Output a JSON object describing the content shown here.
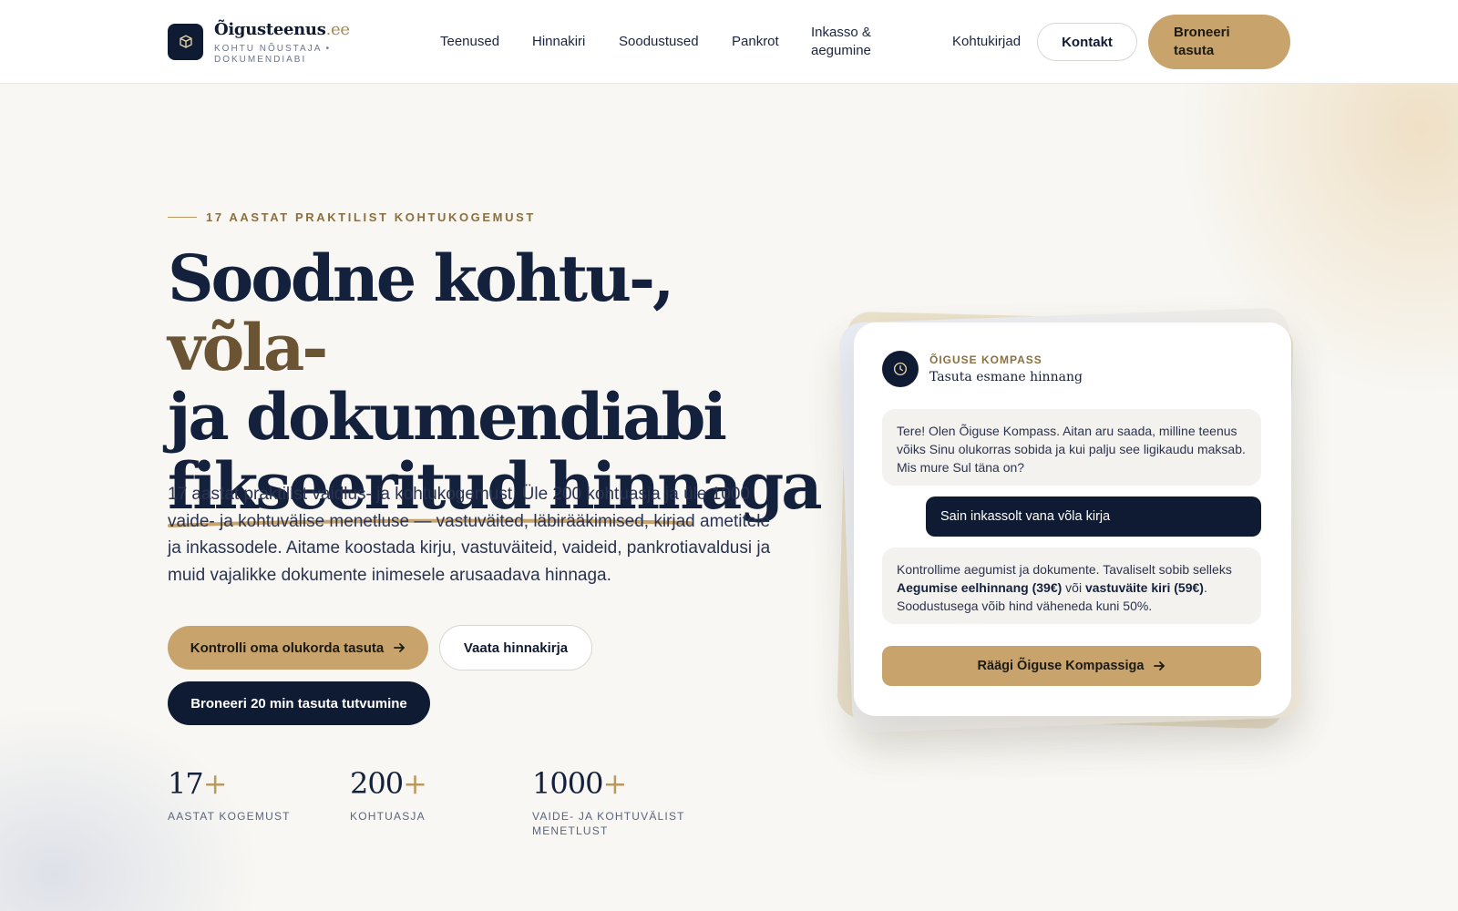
{
  "brand": {
    "name": "Õigusteenus",
    "tld": ".ee",
    "tagline": "KOHTU NÕUSTAJA • DOKUMENDIABI"
  },
  "nav": {
    "items": [
      "Teenused",
      "Hinnakiri",
      "Soodustused",
      "Pankrot",
      "Inkasso & aegumine",
      "Kohtukirjad"
    ],
    "contact_label": "Kontakt",
    "book_label": "Broneeri tasuta"
  },
  "hero": {
    "eyebrow": "17 AASTAT PRAKTILIST KOHTUKOGEMUST",
    "headline_part1": "Soodne kohtu-, ",
    "headline_gold": "võla-",
    "headline_part2": "ja dokumendiabi",
    "headline_underlined": "fikseeritud hinnaga",
    "intro": "17 aastat praktilist vaidlus- ja kohtukogemust. Üle 200 kohtuasja ja üle 1000 vaide- ja kohtuvälise menetluse — vastuväited, läbirääkimised, kirjad ametitele ja inkassodele. Aitame koostada kirju, vastuväiteid, vaideid, pankrotiavaldusi ja muid vajalikke dokumente inimesele arusaadava hinnaga.",
    "cta_primary": "Kontrolli oma olukorda tasuta",
    "cta_secondary": "Vaata hinnakirja",
    "cta_dark": "Broneeri 20 min tasuta tutvumine"
  },
  "stats": [
    {
      "value": "17",
      "suffix": "+",
      "label": "AASTAT KOGEMUST"
    },
    {
      "value": "200",
      "suffix": "+",
      "label": "KOHTUASJA"
    },
    {
      "value": "1000",
      "suffix": "+",
      "label": "VAIDE- JA KOHTUVÄLIST MENETLUST"
    }
  ],
  "chat": {
    "eyebrow": "ÕIGUSE KOMPASS",
    "title": "Tasuta esmane hinnang",
    "greeting": "Tere! Olen Õiguse Kompass. Aitan aru saada, milline teenus võiks Sinu olukorras sobida ja kui palju see ligikaudu maksab. Mis mure Sul täna on?",
    "user_message": "Sain inkassolt vana võla kirja",
    "reply_before": "Kontrollime aegumist ja dokumente. Tavaliselt sobib selleks ",
    "reply_bold1": "Aegumise eelhinnang (39€)",
    "reply_mid": " või ",
    "reply_bold2": "vastuväite kiri (59€)",
    "reply_after": ". Soodustusega võib hind väheneda kuni 50%.",
    "cta": "Räägi Õiguse Kompassiga"
  },
  "colors": {
    "navy": "#0f1a33",
    "gold": "#c8a46c",
    "gold_text": "#8a7040"
  }
}
